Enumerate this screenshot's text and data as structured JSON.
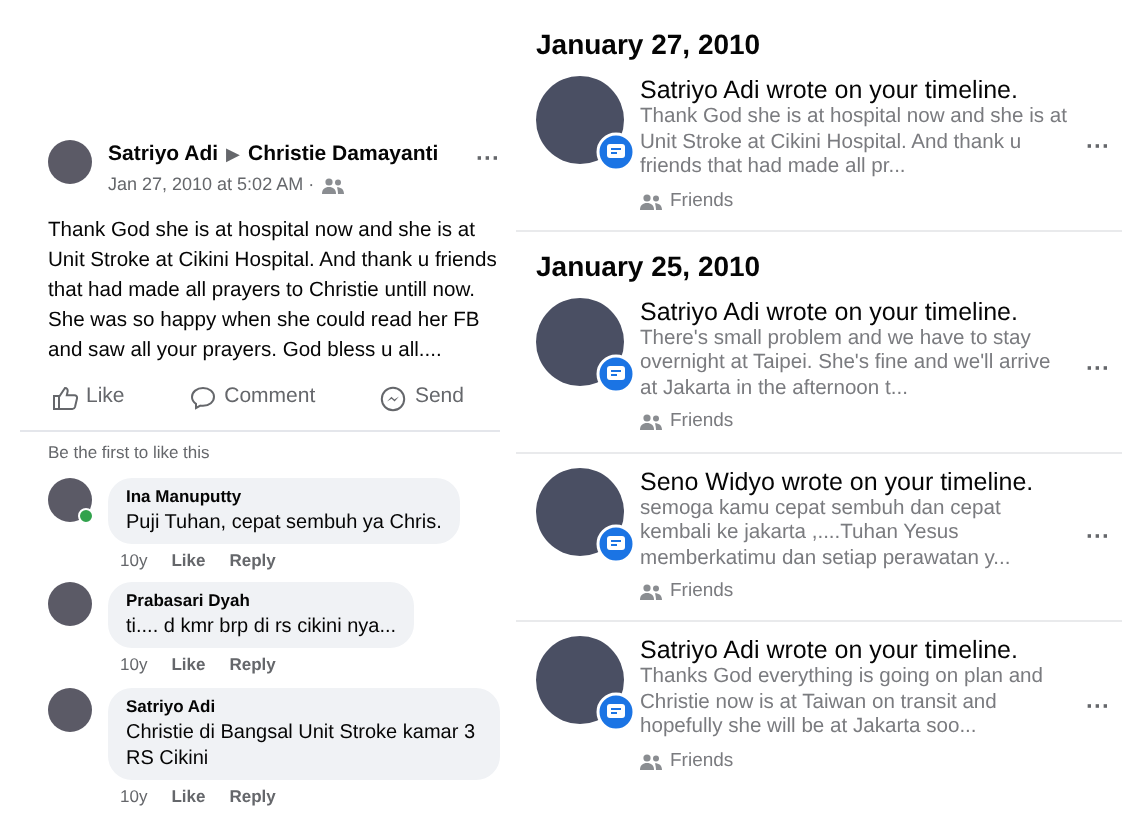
{
  "post": {
    "author": "Satriyo Adi",
    "separator": "▶",
    "target": "Christie Damayanti",
    "time": "Jan 27, 2010 at 5:02 AM ·",
    "more": "···",
    "text": "Thank God she is at hospital now and she is at Unit Stroke at Cikini Hospital. And thank u friends that had made all prayers to Christie untill now. She was so happy when she could read her FB and saw all your prayers. God bless u all....",
    "actions": [
      {
        "kind": "like",
        "label": "Like"
      },
      {
        "kind": "comment",
        "label": "Comment"
      },
      {
        "kind": "send",
        "label": "Send"
      }
    ],
    "likes_note": "Be the first to like this",
    "comments": [
      {
        "author": "Ina Manuputty",
        "online": true,
        "text": "Puji Tuhan, cepat sembuh ya Chris.",
        "age": "10y",
        "like": "Like",
        "reply": "Reply"
      },
      {
        "author": "Prabasari Dyah",
        "online": false,
        "text": "ti.... d kmr brp di rs cikini nya...",
        "age": "10y",
        "like": "Like",
        "reply": "Reply"
      },
      {
        "author": "Satriyo Adi",
        "online": false,
        "text": "Christie di Bangsal Unit Stroke kamar 3 RS Cikini",
        "age": "10y",
        "like": "Like",
        "reply": "Reply"
      }
    ]
  },
  "timeline": [
    {
      "date": "January 27, 2010",
      "items": [
        {
          "title": "Satriyo Adi wrote on your timeline.",
          "preview": "Thank God she is at hospital now and she is at Unit Stroke at Cikini Hospital. And thank u friends that had made all pr...",
          "audience": "Friends",
          "more": "···"
        }
      ]
    },
    {
      "date": "January 25, 2010",
      "items": [
        {
          "title": "Satriyo Adi wrote on your timeline.",
          "preview": "There's small problem and we have to stay overnight at Taipei. She's fine and we'll arrive at Jakarta in the afternoon t...",
          "audience": "Friends",
          "more": "···"
        },
        {
          "title": "Seno Widyo wrote on your timeline.",
          "preview": "semoga kamu cepat sembuh dan cepat kembali ke jakarta ,....Tuhan Yesus memberkatimu dan setiap perawatan y...",
          "audience": "Friends",
          "more": "···"
        },
        {
          "title": "Satriyo Adi wrote on your timeline.",
          "preview": "Thanks God everything is going on plan and Christie now is at Taiwan on transit and hopefully she will be at Jakarta soo...",
          "audience": "Friends",
          "more": "···"
        }
      ]
    }
  ]
}
